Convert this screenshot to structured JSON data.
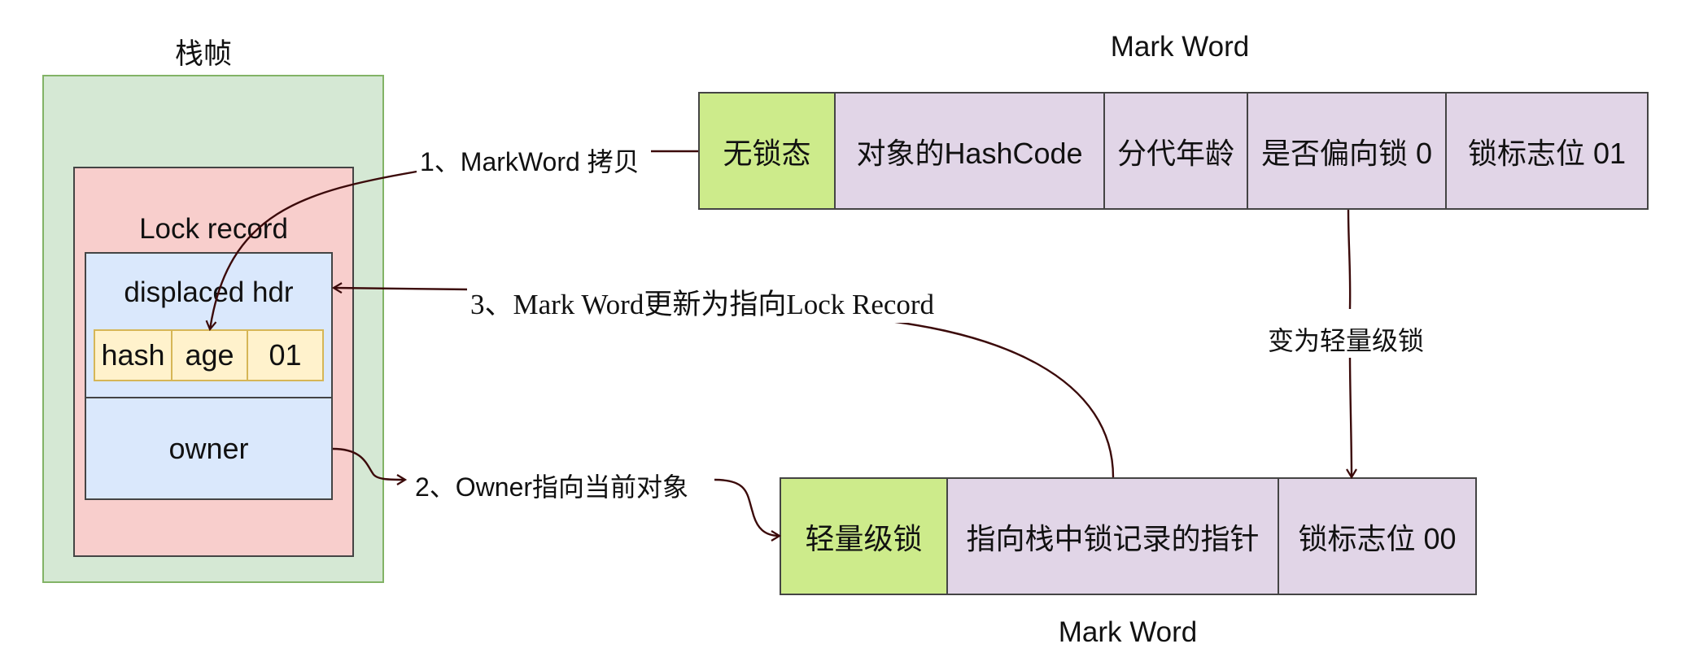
{
  "stack_frame": {
    "title": "栈帧",
    "lock_record": {
      "title": "Lock record",
      "displaced_hdr": "displaced hdr",
      "cells": [
        "hash",
        "age",
        "01"
      ],
      "owner": "owner"
    }
  },
  "top_markword": {
    "title": "Mark Word",
    "cells": [
      "无锁态",
      "对象的HashCode",
      "分代年龄",
      "是否偏向锁 0",
      "锁标志位 01"
    ]
  },
  "bottom_markword": {
    "title": "Mark Word",
    "cells": [
      "轻量级锁",
      "指向栈中锁记录的指针",
      "锁标志位 00"
    ]
  },
  "arrows": {
    "step1": "1、MarkWord 拷贝",
    "step2": "2、Owner指向当前对象",
    "step3": "3、Mark Word更新为指向Lock Record",
    "transition": "变为轻量级锁"
  },
  "colors": {
    "frame": "#d5e8d4",
    "lock_record": "#f8cecc",
    "displaced": "#dae8fc",
    "cell_yellow": "#fff2cc",
    "state_green": "#cdeb8b",
    "field_purple": "#e1d5e7",
    "arrow": "#3b0a0a"
  }
}
